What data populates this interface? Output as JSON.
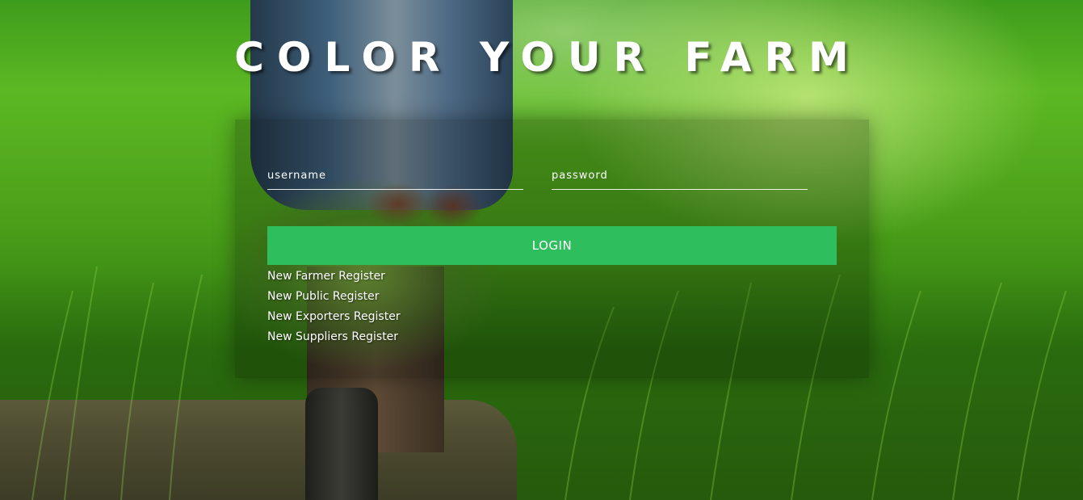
{
  "header": {
    "title": "COLOR YOUR FARM"
  },
  "login_form": {
    "username_placeholder": "username",
    "password_placeholder": "password",
    "login_label": "LOGIN"
  },
  "register_links": [
    {
      "label": "New Farmer Register"
    },
    {
      "label": "New Public Register"
    },
    {
      "label": "New Exporters Register"
    },
    {
      "label": "New Suppliers Register"
    }
  ],
  "colors": {
    "login_button": "#2fbe5e",
    "text": "#ffffff"
  }
}
